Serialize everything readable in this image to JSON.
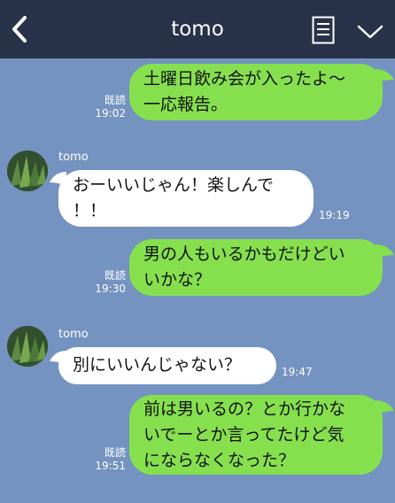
{
  "header": {
    "title": "tomo",
    "back_icon": "chevron-left-icon",
    "memo_icon": "notes-icon",
    "menu_icon": "chevron-down-icon",
    "bg_color": "#283249"
  },
  "colors": {
    "chat_bg": "#7493c0",
    "sent_bubble": "#86e04e",
    "received_bubble": "#ffffff"
  },
  "messages": [
    {
      "direction": "sent",
      "text": "土曜日飲み会が入ったよ〜\n一応報告。",
      "read": "既読",
      "time": "19:02"
    },
    {
      "direction": "received",
      "sender": "tomo",
      "text": "おーいいじゃん！楽しんで\n！！",
      "time": "19:19"
    },
    {
      "direction": "sent",
      "text": "男の人もいるかもだけどい\nいかな？",
      "read": "既読",
      "time": "19:30"
    },
    {
      "direction": "received",
      "sender": "tomo",
      "text": "別にいいんじゃない？",
      "time": "19:47"
    },
    {
      "direction": "sent",
      "text": "前は男いるの？とか行かな\nいでーとか言ってたけど気\nにならなくなった？",
      "read": "既読",
      "time": "19:51"
    }
  ]
}
